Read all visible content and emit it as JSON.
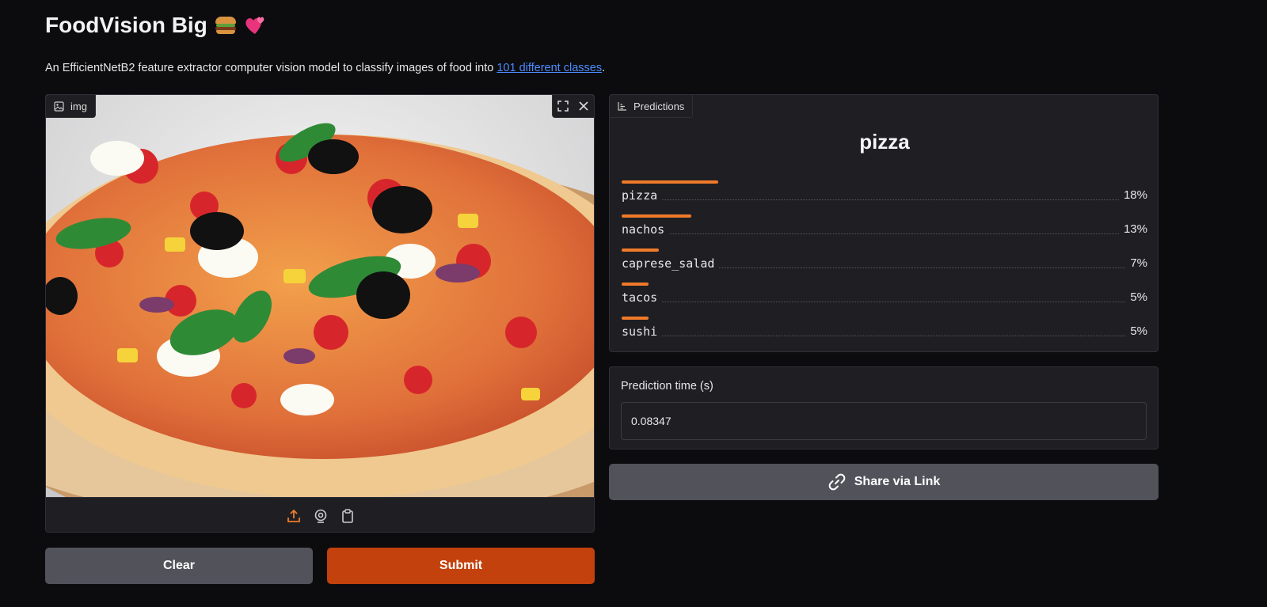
{
  "header": {
    "title": "FoodVision Big",
    "description_prefix": "An EfficientNetB2 feature extractor computer vision model to classify images of food into ",
    "description_link": "101 different classes",
    "description_suffix": "."
  },
  "image_input": {
    "label": "img",
    "icons": [
      "image-icon",
      "fullscreen-icon",
      "close-icon",
      "upload-icon",
      "webcam-icon",
      "clipboard-icon"
    ]
  },
  "buttons": {
    "clear": "Clear",
    "submit": "Submit",
    "share": "Share via Link"
  },
  "predictions": {
    "label": "Predictions",
    "top_class": "pizza",
    "items": [
      {
        "name": "pizza",
        "value": "18%",
        "fraction": 0.18
      },
      {
        "name": "nachos",
        "value": "13%",
        "fraction": 0.13
      },
      {
        "name": "caprese_salad",
        "value": "7%",
        "fraction": 0.07
      },
      {
        "name": "tacos",
        "value": "5%",
        "fraction": 0.05
      },
      {
        "name": "sushi",
        "value": "5%",
        "fraction": 0.05
      }
    ]
  },
  "prediction_time": {
    "label": "Prediction time (s)",
    "value": "0.08347"
  },
  "colors": {
    "accent": "#f07a2a",
    "submit": "#c2410c",
    "secondary_button": "#52525b",
    "link": "#4e8cff",
    "background": "#0c0c0f"
  }
}
